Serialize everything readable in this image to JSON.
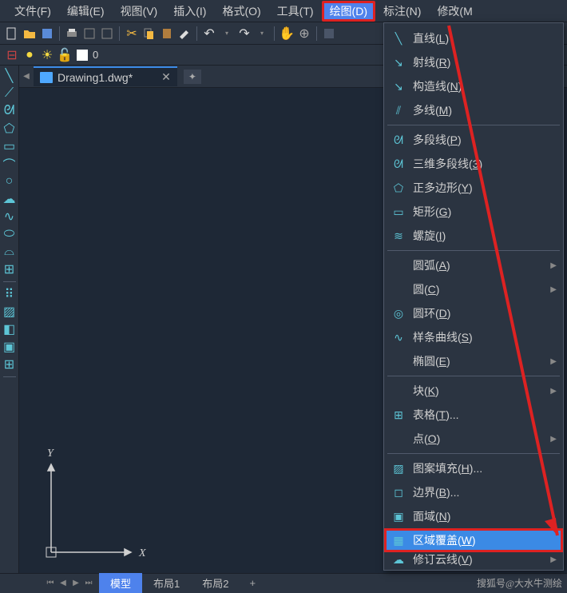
{
  "menubar": {
    "items": [
      {
        "label": "文件(F)"
      },
      {
        "label": "编辑(E)"
      },
      {
        "label": "视图(V)"
      },
      {
        "label": "插入(I)"
      },
      {
        "label": "格式(O)"
      },
      {
        "label": "工具(T)"
      },
      {
        "label": "绘图(D)",
        "active": true
      },
      {
        "label": "标注(N)"
      },
      {
        "label": "修改(M"
      }
    ]
  },
  "file_tab": {
    "name": "Drawing1.dwg*"
  },
  "layerbar": {
    "current": "0"
  },
  "ucs": {
    "x_label": "X",
    "y_label": "Y"
  },
  "bottom_tabs": {
    "items": [
      {
        "label": "模型",
        "active": true
      },
      {
        "label": "布局1"
      },
      {
        "label": "布局2"
      }
    ],
    "add": "+"
  },
  "dropdown": {
    "groups": [
      [
        {
          "icon": "╲",
          "label": "直线",
          "key": "L"
        },
        {
          "icon": "↘",
          "label": "射线",
          "key": "R"
        },
        {
          "icon": "↘",
          "label": "构造线",
          "key": "N"
        },
        {
          "icon": "⫽",
          "label": "多线",
          "key": "M"
        }
      ],
      [
        {
          "icon": "ᘛ",
          "label": "多段线",
          "key": "P"
        },
        {
          "icon": "ᘛ",
          "label": "三维多段线",
          "key": "3"
        },
        {
          "icon": "⬠",
          "label": "正多边形",
          "key": "Y"
        },
        {
          "icon": "▭",
          "label": "矩形",
          "key": "G"
        },
        {
          "icon": "≋",
          "label": "螺旋",
          "key": "I"
        }
      ],
      [
        {
          "icon": "",
          "label": "圆弧",
          "key": "A",
          "sub": true
        },
        {
          "icon": "",
          "label": "圆",
          "key": "C",
          "sub": true
        },
        {
          "icon": "◎",
          "label": "圆环",
          "key": "D"
        },
        {
          "icon": "∿",
          "label": "样条曲线",
          "key": "S"
        },
        {
          "icon": "",
          "label": "椭圆",
          "key": "E",
          "sub": true
        }
      ],
      [
        {
          "icon": "",
          "label": "块",
          "key": "K",
          "sub": true
        },
        {
          "icon": "⊞",
          "label": "表格",
          "key": "T",
          "suffix": "..."
        },
        {
          "icon": "",
          "label": "点",
          "key": "O",
          "sub": true
        }
      ],
      [
        {
          "icon": "▨",
          "label": "图案填充",
          "key": "H",
          "suffix": "..."
        },
        {
          "icon": "◻",
          "label": "边界",
          "key": "B",
          "suffix": "..."
        },
        {
          "icon": "▣",
          "label": "面域",
          "key": "N"
        },
        {
          "icon": "▦",
          "label": "区域覆盖",
          "key": "W",
          "hl": true
        },
        {
          "icon": "☁",
          "label": "修订云线",
          "key": "V",
          "cut": true,
          "sub": true
        }
      ]
    ]
  },
  "watermark": "搜狐号@大水牛测绘"
}
